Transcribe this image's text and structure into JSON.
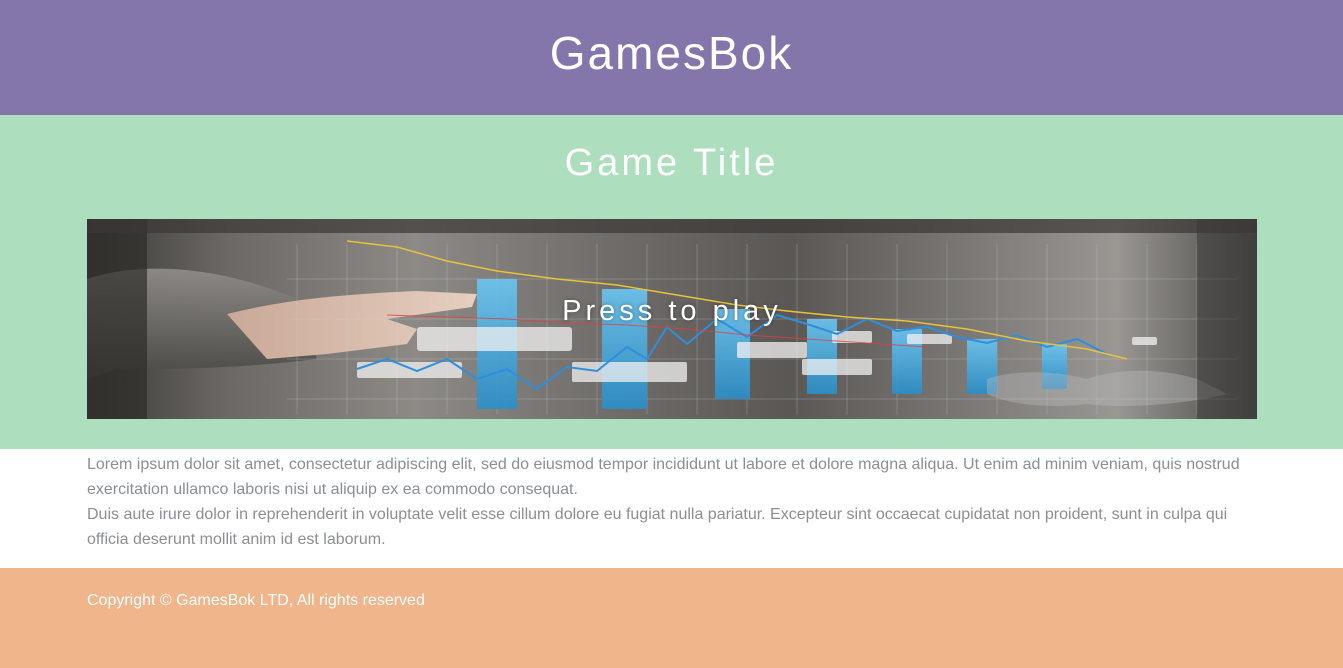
{
  "header": {
    "site_title": "GamesBok"
  },
  "hero": {
    "game_title": "Game Title",
    "play_label": "Press to play"
  },
  "content": {
    "paragraph_1": "Lorem ipsum dolor sit amet, consectetur adipiscing elit, sed do eiusmod tempor incididunt ut labore et dolore magna aliqua. Ut enim ad minim veniam, quis nostrud exercitation ullamco laboris nisi ut aliquip ex ea commodo consequat.",
    "paragraph_2": "Duis aute irure dolor in reprehenderit in voluptate velit esse cillum dolore eu fugiat nulla pariatur. Excepteur sint occaecat cupidatat non proident, sunt in culpa qui officia deserunt mollit anim id est laborum."
  },
  "footer": {
    "copyright": "Copyright © GamesBok LTD, All rights reserved"
  },
  "colors": {
    "header_bg": "#8475ab",
    "hero_bg": "#addfbe",
    "footer_bg": "#f0b58b",
    "body_text": "#8a8f94"
  }
}
